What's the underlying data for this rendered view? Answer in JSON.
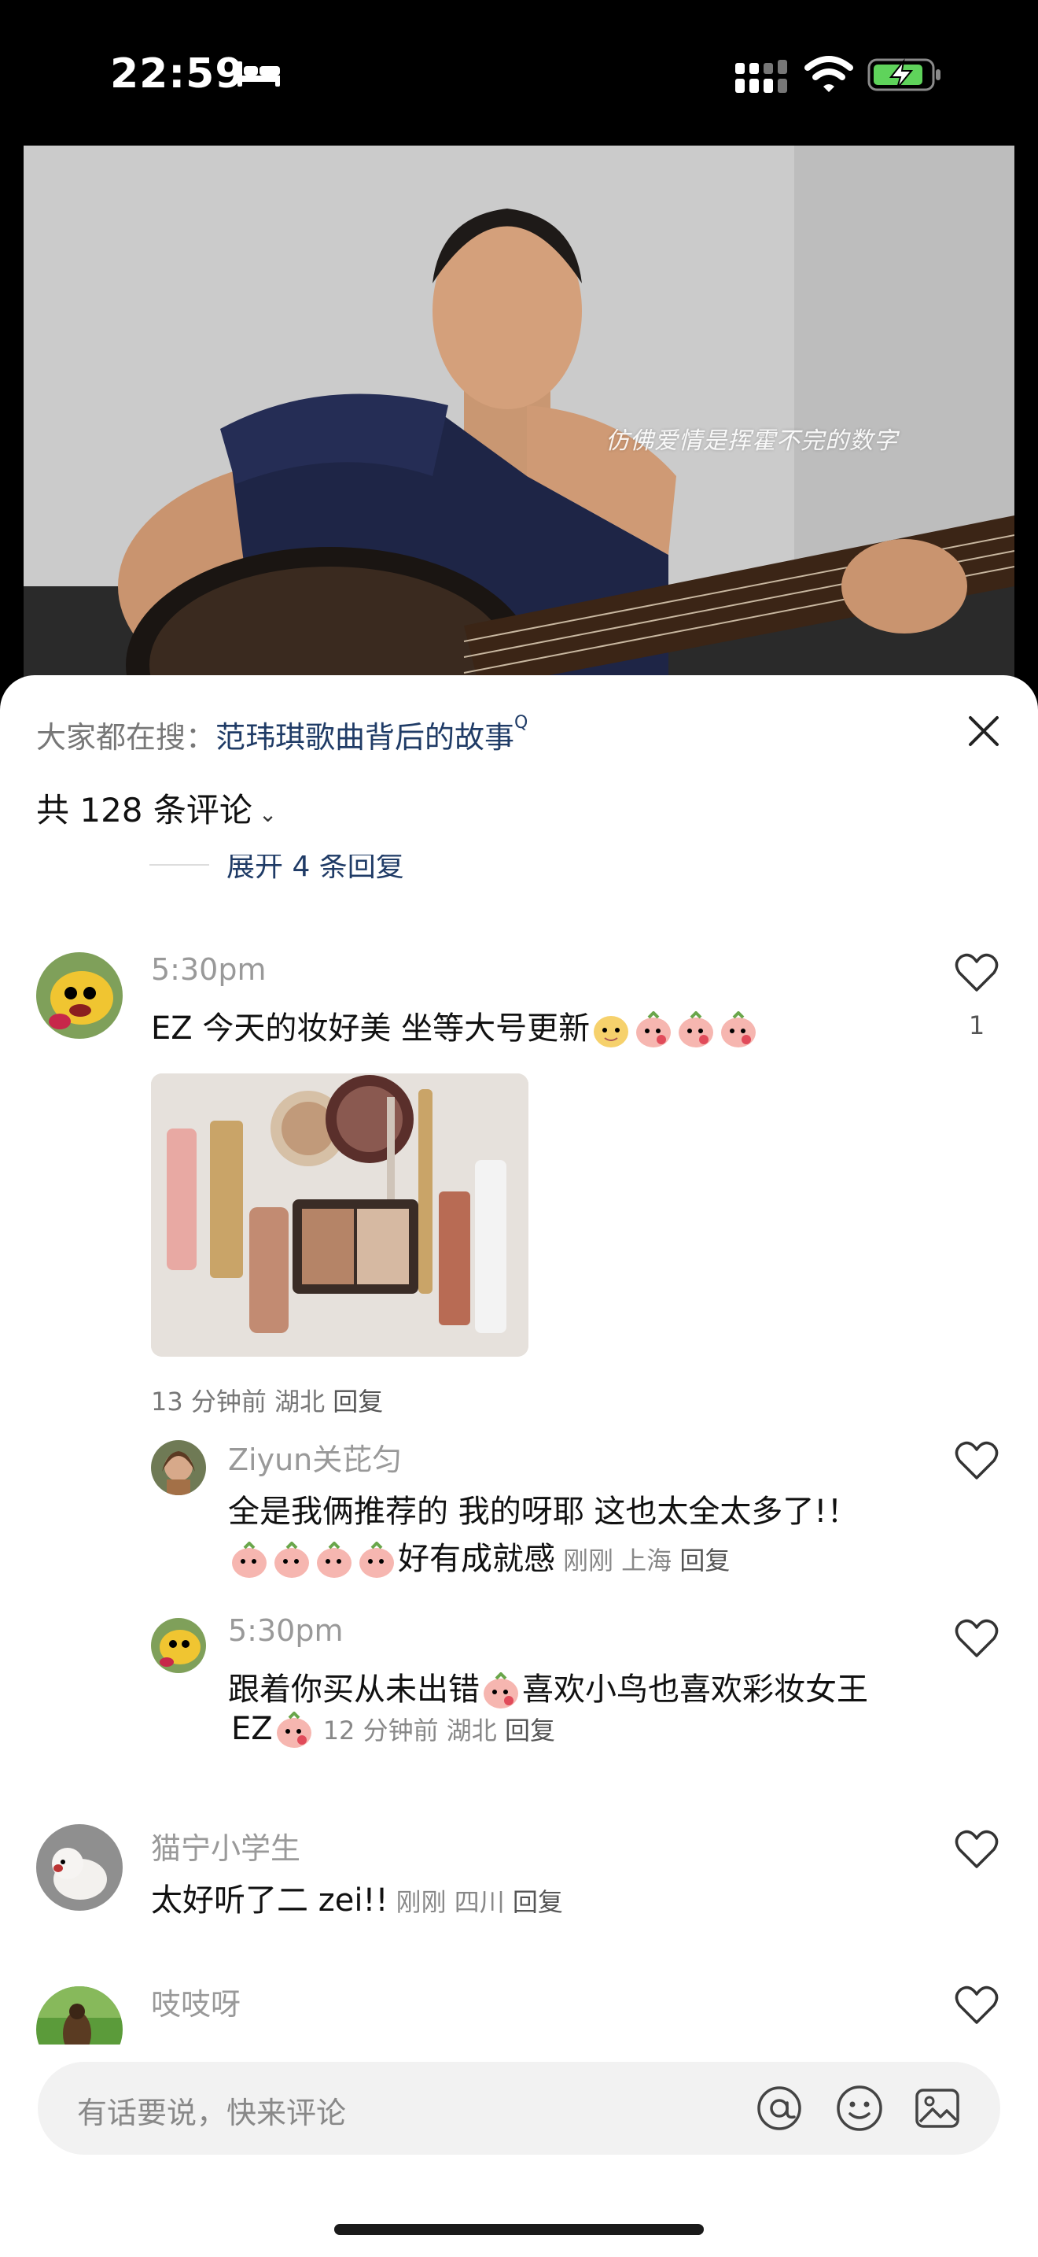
{
  "status_bar": {
    "time": "22:59",
    "icons": [
      "bed-icon",
      "cellular-signal-icon",
      "wifi-icon",
      "battery-charging-icon"
    ]
  },
  "video": {
    "caption": "仿佛爱情是挥霍不完的数字"
  },
  "sheet": {
    "trending_prefix": "大家都在搜：",
    "trending_topic": "范玮琪歌曲背后的故事",
    "comment_count_label": "共 128 条评论",
    "expand_replies_label": "展开 4 条回复"
  },
  "comments": {
    "c1": {
      "time_name": "5:30pm",
      "text": "EZ 今天的妆好美 坐等大号更新",
      "meta": "13 分钟前  湖北  ",
      "reply": "回复",
      "like_count": "1",
      "photo_desc": "makeup-products-photo"
    },
    "r1": {
      "name": "Ziyun关芘匀",
      "text_line1": "全是我俩推荐的 我的呀耶 这也太全太多了!！",
      "text_line2": "好有成就感",
      "meta": "刚刚  上海  ",
      "reply": "回复"
    },
    "r2": {
      "name": "5:30pm",
      "text_line1_a": "跟着你买从未出错",
      "text_line1_b": "喜欢小鸟也喜欢彩妆女王",
      "text_line2": "EZ",
      "meta": "12 分钟前  湖北  ",
      "reply": "回复"
    },
    "c2": {
      "name": "猫宁小学生",
      "text": "太好听了二 zei!!",
      "meta": "刚刚  四川  ",
      "reply": "回复"
    },
    "c3": {
      "name": "吱吱呀"
    }
  },
  "input": {
    "placeholder": "有话要说，快来评论"
  },
  "colors": {
    "link_blue": "#1f3b66",
    "muted_gray": "#999999",
    "emoji_peach": "#f6b6b0"
  }
}
